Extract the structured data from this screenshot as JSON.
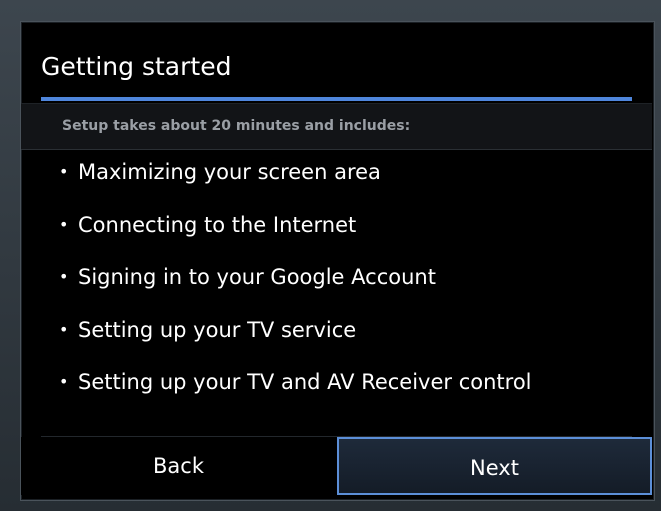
{
  "dialog": {
    "title": "Getting started",
    "subheader": "Setup takes about 20 minutes and includes:",
    "bullet": "•",
    "items": [
      {
        "label": "Maximizing your screen area"
      },
      {
        "label": "Connecting to the Internet"
      },
      {
        "label": "Signing in to your Google Account"
      },
      {
        "label": "Setting up your TV service"
      },
      {
        "label": "Setting up your TV and AV Receiver control"
      }
    ],
    "buttons": {
      "back_label": "Back",
      "next_label": "Next"
    }
  },
  "colors": {
    "accent": "#4f86dc",
    "focus_border": "#5c8fd8",
    "background": "#000000",
    "text": "#ffffff",
    "subtext": "#9a9fa5"
  }
}
